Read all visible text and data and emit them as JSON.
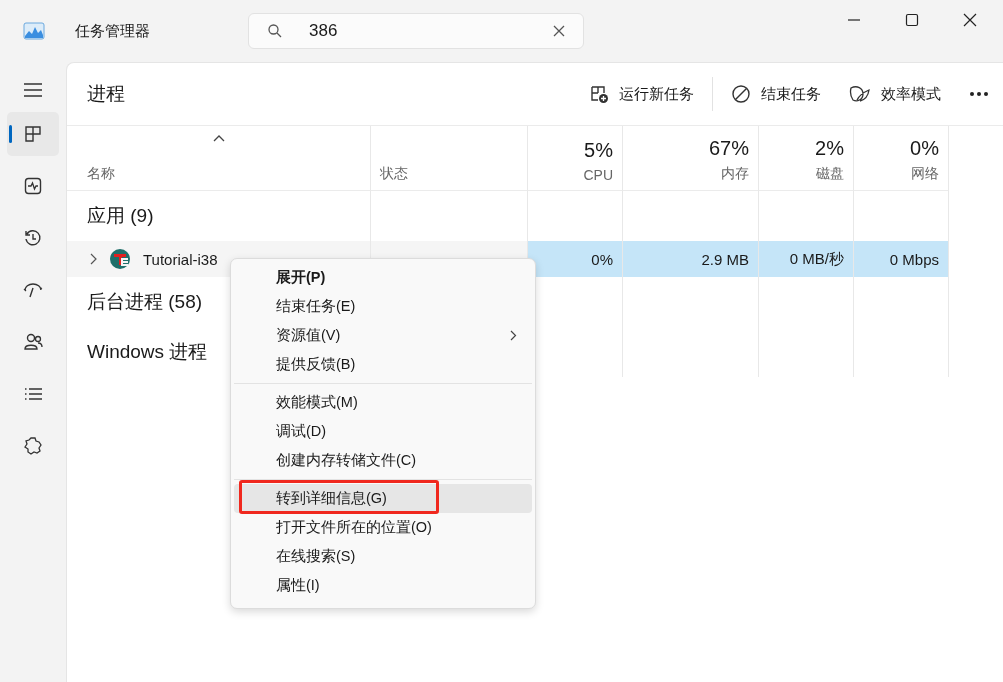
{
  "window": {
    "title": "任务管理器",
    "search": {
      "value": "386"
    }
  },
  "nav": [
    {
      "selected": true
    },
    {
      "selected": false
    },
    {
      "selected": false
    },
    {
      "selected": false
    },
    {
      "selected": false
    },
    {
      "selected": false
    },
    {
      "selected": false
    }
  ],
  "page": {
    "title": "进程"
  },
  "toolbar": [
    {
      "label": "运行新任务"
    },
    {
      "label": "结束任务"
    },
    {
      "label": "效率模式"
    }
  ],
  "columns": [
    {
      "label": "名称",
      "sorted": true
    },
    {
      "label": "状态",
      "sorted": false
    },
    {
      "label": "CPU",
      "usage": "5%",
      "sorted": false
    },
    {
      "label": "内存",
      "usage": "67%",
      "sorted": false
    },
    {
      "label": "磁盘",
      "usage": "2%",
      "sorted": false
    },
    {
      "label": "网络",
      "usage": "0%",
      "sorted": false
    }
  ],
  "groups": [
    {
      "label": "应用 (9)",
      "rows": [
        {
          "name": "Tutorial-i38",
          "expandable": true,
          "selected": true,
          "values": [
            "0%",
            "2.9 MB",
            "0 MB/秒",
            "0 Mbps"
          ]
        }
      ]
    },
    {
      "label": "后台进程 (58)"
    },
    {
      "label": "Windows 进程"
    }
  ],
  "context_menu": {
    "items": [
      {
        "kind": "item",
        "label": "展开(P)",
        "default": true,
        "submenu": false,
        "selected": false,
        "marked": false
      },
      {
        "kind": "item",
        "label": "结束任务(E)",
        "default": false,
        "submenu": false,
        "selected": false,
        "marked": false
      },
      {
        "kind": "item",
        "label": "资源值(V)",
        "default": false,
        "submenu": true,
        "selected": false,
        "marked": false
      },
      {
        "kind": "item",
        "label": "提供反馈(B)",
        "default": false,
        "submenu": false,
        "selected": false,
        "marked": false
      },
      {
        "kind": "separator"
      },
      {
        "kind": "item",
        "label": "效能模式(M)",
        "default": false,
        "submenu": false,
        "selected": false,
        "marked": false
      },
      {
        "kind": "item",
        "label": "调试(D)",
        "default": false,
        "submenu": false,
        "selected": false,
        "marked": false
      },
      {
        "kind": "item",
        "label": "创建内存转储文件(C)",
        "default": false,
        "submenu": false,
        "selected": false,
        "marked": false
      },
      {
        "kind": "separator"
      },
      {
        "kind": "item",
        "label": "转到详细信息(G)",
        "default": false,
        "submenu": false,
        "selected": true,
        "marked": true
      },
      {
        "kind": "item",
        "label": "打开文件所在的位置(O)",
        "default": false,
        "submenu": false,
        "selected": false,
        "marked": false
      },
      {
        "kind": "item",
        "label": "在线搜索(S)",
        "default": false,
        "submenu": false,
        "selected": false,
        "marked": false
      },
      {
        "kind": "item",
        "label": "属性(I)",
        "default": false,
        "submenu": false,
        "selected": false,
        "marked": false
      }
    ]
  }
}
